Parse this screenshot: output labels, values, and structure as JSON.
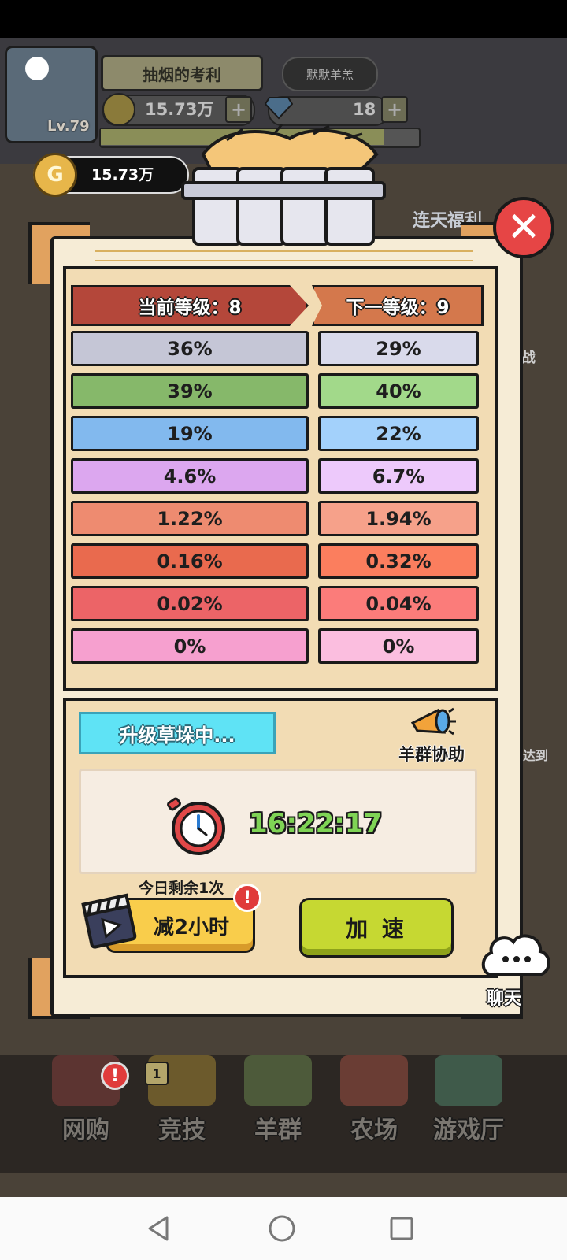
{
  "header": {
    "player_name": "抽烟的考利",
    "tag_label": "默默羊羔",
    "level_text": "Lv.79",
    "gold_amount": "15.73万",
    "gem_amount": "18",
    "plus_symbol": "+"
  },
  "coin_pill": {
    "icon_letter": "G",
    "amount": "15.73万"
  },
  "background": {
    "event_label": "连天福利",
    "side_text_1": "战",
    "side_text_2": "达到"
  },
  "dialog": {
    "current_level_header": "当前等级：8",
    "next_level_header": "下一等级：9",
    "rows": [
      {
        "current": "36%",
        "next": "29%",
        "color_current": "#c5c6d6",
        "color_next": "#d9daeb"
      },
      {
        "current": "39%",
        "next": "40%",
        "color_current": "#86b86a",
        "color_next": "#a2d98a"
      },
      {
        "current": "19%",
        "next": "22%",
        "color_current": "#82b9ee",
        "color_next": "#a3d1fb"
      },
      {
        "current": "4.6%",
        "next": "6.7%",
        "color_current": "#dca7ef",
        "color_next": "#edc9fb"
      },
      {
        "current": "1.22%",
        "next": "1.94%",
        "color_current": "#ee8b70",
        "color_next": "#f6a18a"
      },
      {
        "current": "0.16%",
        "next": "0.32%",
        "color_current": "#e96a4e",
        "color_next": "#fb7e5e"
      },
      {
        "current": "0.02%",
        "next": "0.04%",
        "color_current": "#ec6467",
        "color_next": "#fb7c7a"
      },
      {
        "current": "0%",
        "next": "0%",
        "color_current": "#f6a0cf",
        "color_next": "#fbbedf"
      }
    ],
    "upgrade_status": "升级草垛中...",
    "flock_help": "羊群协助",
    "timer": "16:22:17",
    "remaining_today": "今日剩余1次",
    "reduce_button": "减2小时",
    "alert_mark": "!",
    "speed_button": "加 速",
    "close_symbol": "✕"
  },
  "chat": {
    "label": "聊天"
  },
  "bottom_nav": {
    "items": [
      {
        "label": "网购",
        "badge": "!"
      },
      {
        "label": "竞技",
        "badge": "1"
      },
      {
        "label": "羊群"
      },
      {
        "label": "农场"
      },
      {
        "label": "游戏厅"
      }
    ]
  }
}
